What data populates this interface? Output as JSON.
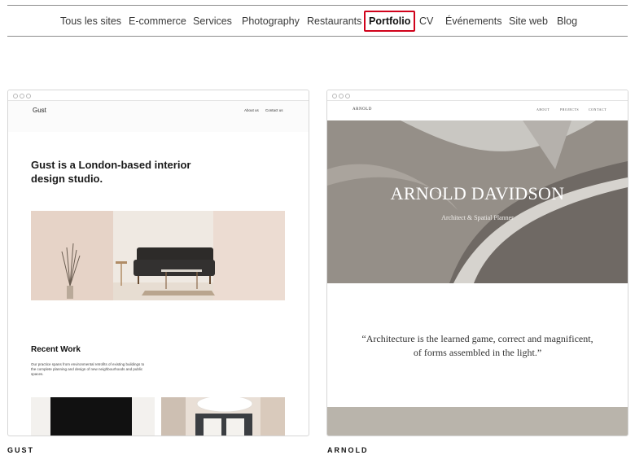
{
  "nav": {
    "items": [
      {
        "label": "Tous les sites",
        "active": false
      },
      {
        "label": "E-commerce",
        "active": false
      },
      {
        "label": "Services",
        "active": false
      },
      {
        "label": "Photography",
        "active": false
      },
      {
        "label": "Restaurants",
        "active": false
      },
      {
        "label": "Portfolio",
        "active": true
      },
      {
        "label": "CV",
        "active": false
      },
      {
        "label": "Événements",
        "active": false
      },
      {
        "label": "Site web",
        "active": false
      },
      {
        "label": "Blog",
        "active": false
      }
    ],
    "active_outline_color": "#d0021b"
  },
  "templates": [
    {
      "label": "GUST",
      "preview": {
        "logo": "Gust",
        "menu": [
          "About us",
          "Contact us"
        ],
        "hero": "Gust is a London-based interior design studio.",
        "section_title": "Recent Work",
        "section_body": "Our practice spans from environmental retrofits of existing buildings to the complete planning and design of new neighbourhoods and public spaces."
      }
    },
    {
      "label": "ARNOLD",
      "preview": {
        "logo": "ARNOLD",
        "menu": [
          "ABOUT",
          "PROJECTS",
          "CONTACT"
        ],
        "title": "ARNOLD DAVIDSON",
        "subtitle": "Architect & Spatial Planner",
        "quote": "“Architecture is the learned game, correct and magnificent, of forms assembled in the light.”"
      }
    }
  ]
}
